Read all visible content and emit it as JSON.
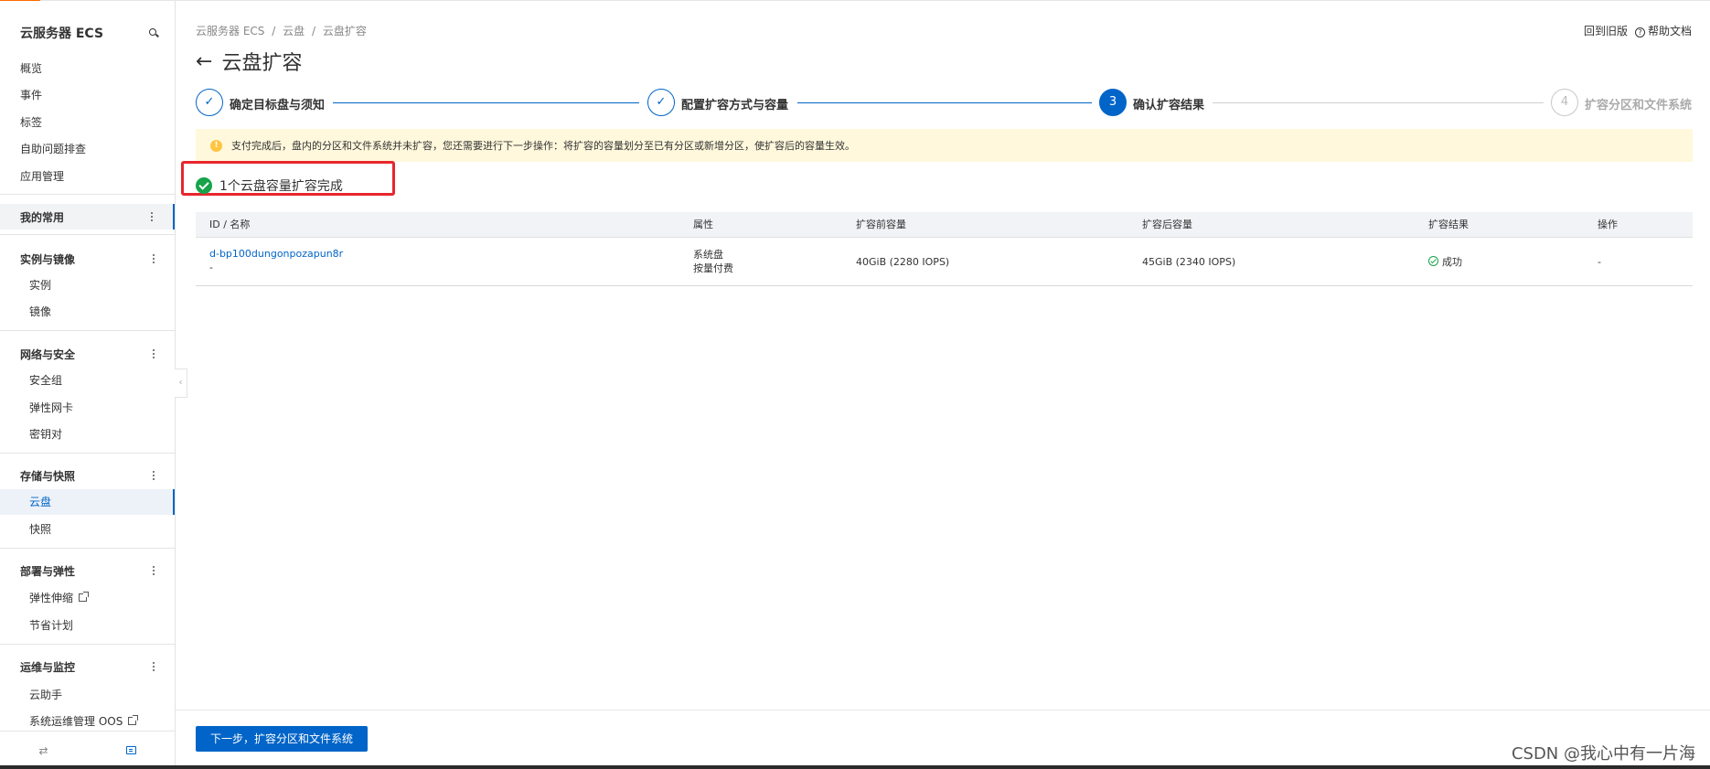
{
  "sidebar": {
    "title": "云服务器 ECS",
    "top_items": [
      "概览",
      "事件",
      "标签",
      "自助问题排查",
      "应用管理"
    ],
    "favorites_label": "我的常用",
    "groups": [
      {
        "label": "实例与镜像",
        "items": [
          "实例",
          "镜像"
        ]
      },
      {
        "label": "网络与安全",
        "items": [
          "安全组",
          "弹性网卡",
          "密钥对"
        ]
      },
      {
        "label": "存储与快照",
        "items": [
          "云盘",
          "快照"
        ]
      },
      {
        "label": "部署与弹性",
        "items": [
          "弹性伸缩",
          "节省计划"
        ]
      },
      {
        "label": "运维与监控",
        "items": [
          "云助手",
          "系统运维管理 OOS"
        ]
      }
    ],
    "active_item": "云盘"
  },
  "breadcrumb": [
    "云服务器 ECS",
    "/",
    "云盘",
    "/",
    "云盘扩容"
  ],
  "top_links": {
    "old": "回到旧版",
    "help": "帮助文档"
  },
  "page_title": "云盘扩容",
  "steps": [
    {
      "label": "确定目标盘与须知",
      "status": "done"
    },
    {
      "label": "配置扩容方式与容量",
      "status": "done"
    },
    {
      "number": "3",
      "label": "确认扩容结果",
      "status": "current"
    },
    {
      "number": "4",
      "label": "扩容分区和文件系统",
      "status": "pending"
    }
  ],
  "notice": "支付完成后，盘内的分区和文件系统并未扩容，您还需要进行下一步操作：将扩容的容量划分至已有分区或新增分区，使扩容后的容量生效。",
  "result_title": "1个云盘容量扩容完成",
  "table": {
    "headers": [
      "ID / 名称",
      "属性",
      "扩容前容量",
      "扩容后容量",
      "扩容结果",
      "操作"
    ],
    "rows": [
      {
        "id": "d-bp100dungonpozapun8r",
        "name": "-",
        "attr1": "系统盘",
        "attr2": "按量付费",
        "before": "40GiB (2280 IOPS)",
        "after": "45GiB (2340 IOPS)",
        "result": "成功",
        "action": "-"
      }
    ]
  },
  "next_button": "下一步，扩容分区和文件系统",
  "watermark": "CSDN @我心中有一片海",
  "colors": {
    "primary": "#0064c8",
    "success": "#16a34a",
    "warning_bg": "#fff8dc",
    "highlight": "#e8262c"
  }
}
